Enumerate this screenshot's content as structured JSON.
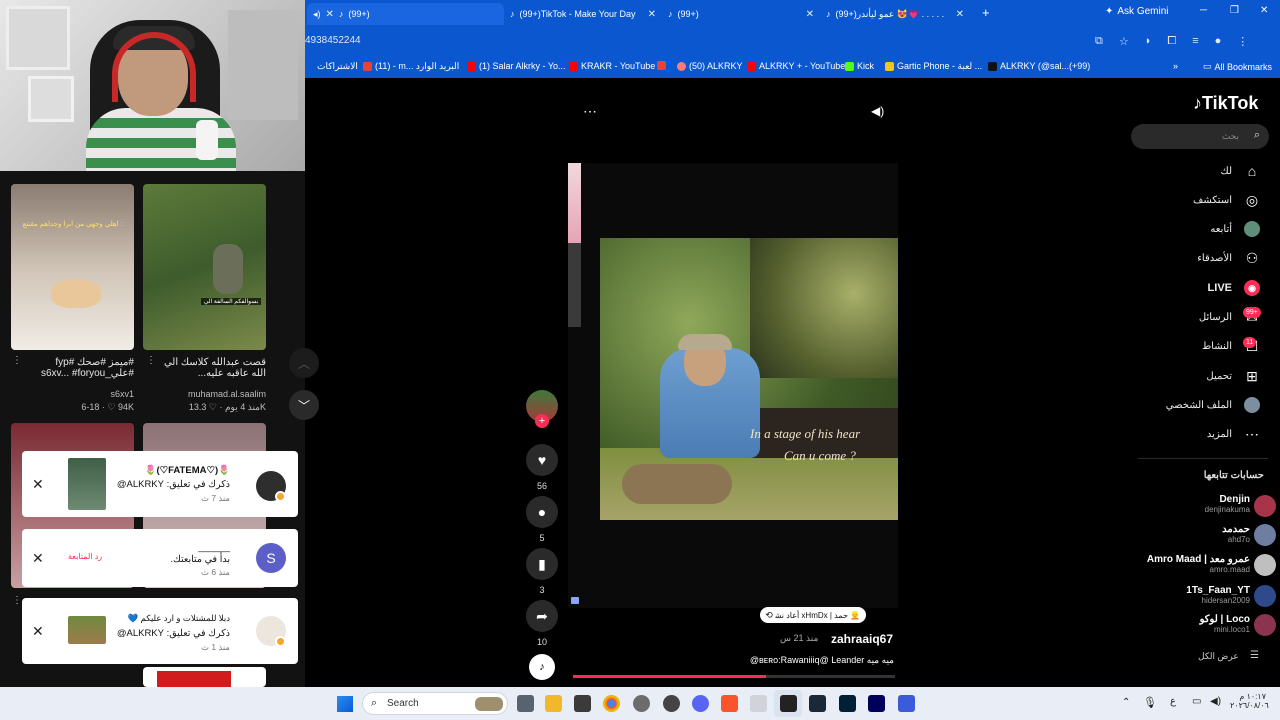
{
  "browser": {
    "tabs": [
      {
        "label": "(99+)",
        "active": true
      },
      {
        "label": "(99+)TikTok - Make Your Day"
      },
      {
        "label": "(99+)"
      },
      {
        "label": "(99+)عمو ليأندر 😻💗 . . . . ."
      }
    ],
    "new_tab": "+",
    "ask_gemini": "Ask Gemini",
    "url": "4938452244",
    "bookmarks": [
      "الاشتراكات",
      "(11) - m... البريد الوارد",
      "(1) Salar Alkrky - Yo...",
      "KRAKR - YouTube",
      "(50) ALKRKY",
      "ALKRKY + - YouTube",
      "Kick",
      "Gartic Phone - لعبة ...",
      "ALKRKY (@sal...(+99)"
    ],
    "all_bookmarks": "All Bookmarks"
  },
  "left_feed": {
    "videos": [
      {
        "overlay": "اهلي وجهي من ابرا وجداهم مقتنع :",
        "caption": "#ميمز #صحك #fyp #علي_s6xv... #foryou",
        "author": "s6xv1",
        "meta": "6-18 · ♡ 94K"
      },
      {
        "overlay": "بسوالفكم السالفة الي",
        "caption": "قصت عبدالله كلاسك الي الله عاقبه عليه...",
        "author": "muhamad.al.saalim",
        "meta": "منذ 4 يوم · ♡ 13.3K"
      }
    ]
  },
  "notifications": [
    {
      "title": "🌷(♡FATEMA♡)🌷",
      "text": "ذكرك في تعليق: ALKRKY@",
      "time": "منذ 7 ث"
    },
    {
      "title": "______",
      "text": "بدأ في متابعتك.",
      "time": "منذ 6 ث",
      "follow_back": "رد المتابعة",
      "avatar_letter": "S"
    },
    {
      "title": "دبلا للمشتلات و ارد عليكم 💙",
      "text": "ذكرك في تعليق: ALKRKY@",
      "time": "منذ 1 ث"
    }
  ],
  "post": {
    "likes": "56",
    "comments": "5",
    "saves": "3",
    "shares": "10",
    "subtitle_line1": "In a stage of his hear",
    "subtitle_line2": "Can u come ?",
    "repost": "👱 حمد | xHmDx أعاد نشره",
    "author": "zahraaiq67",
    "time": "منذ 21 س",
    "desc": "ميه ميه ʙᴇʀᴏ:Rawaniiiq@ Leander@"
  },
  "tiktok": {
    "logo": "TikTok",
    "search_placeholder": "بحث",
    "nav": [
      {
        "label": "لك",
        "icon": "home-icon",
        "glyph": "⌂"
      },
      {
        "label": "استكشف",
        "icon": "compass-icon",
        "glyph": "◎"
      },
      {
        "label": "أتابعه",
        "icon": "avatar-icon",
        "glyph": "●"
      },
      {
        "label": "الأصدقاء",
        "icon": "friends-icon",
        "glyph": "⚇"
      },
      {
        "label": "LIVE",
        "icon": "live-icon",
        "glyph": "◉"
      },
      {
        "label": "الرسائل",
        "icon": "messages-icon",
        "glyph": "✉",
        "badge": "99+"
      },
      {
        "label": "النشاط",
        "icon": "activity-icon",
        "glyph": "☐",
        "badge": "11"
      },
      {
        "label": "تحميل",
        "icon": "upload-icon",
        "glyph": "⊞"
      },
      {
        "label": "الملف الشخصي",
        "icon": "profile-icon",
        "glyph": "●"
      },
      {
        "label": "المزيد",
        "icon": "more-icon",
        "glyph": "⋯"
      }
    ],
    "following_header": "حسابات تتابعها",
    "following": [
      {
        "name": "Denjin",
        "handle": "denjinakuma"
      },
      {
        "name": "حمدمد",
        "handle": "ahd7o"
      },
      {
        "name": "Amro Maad | عمرو معد",
        "handle": "amro.maad"
      },
      {
        "name": "1Ts_Faan_YT",
        "handle": "hidersan2009"
      },
      {
        "name": "لوكو | Loco",
        "handle": "mini.loco1"
      }
    ],
    "see_all": "عرض الكل"
  },
  "taskbar": {
    "search": "Search",
    "time": "١٠:١٧ م",
    "date": "٢٠٢٦/٠٨/٠٦",
    "lang": "ع"
  }
}
